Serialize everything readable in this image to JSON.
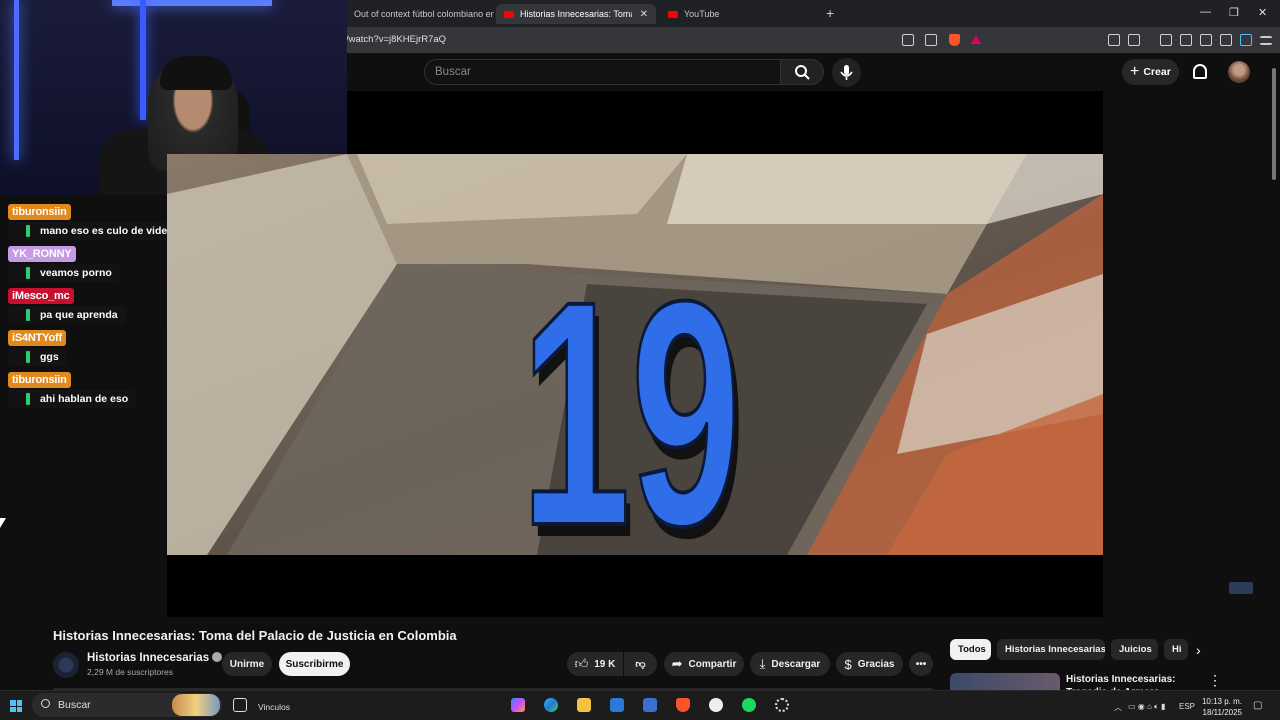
{
  "browser": {
    "tabs": [
      {
        "label": "Out of context fútbol colombiano en",
        "active": false
      },
      {
        "label": "Historias Innecesarias: Toma del",
        "active": true
      },
      {
        "label": "YouTube",
        "active": false
      }
    ],
    "url": "/watch?v=j8KHEjrR7aQ",
    "new_tab_icon": "plus-icon"
  },
  "youtube": {
    "search_placeholder": "Buscar",
    "create_label": "Crear",
    "video": {
      "overlay_numeral": "19",
      "title": "Historias Innecesarias: Toma del Palacio de Justicia en Colombia",
      "channel": "Historias Innecesarias",
      "subscribers": "2,29 M de suscriptores",
      "join_label": "Unirme",
      "subscribe_label": "Suscribirme",
      "likes": "19 K",
      "share_label": "Compartir",
      "download_label": "Descargar",
      "thanks_label": "Gracias"
    },
    "chips": [
      "Todos",
      "Historias Innecesarias",
      "Juicios",
      "Hi"
    ],
    "recommended": {
      "title": "Historias Innecesarias: Tragedia de Armero"
    }
  },
  "chat": {
    "messages": [
      {
        "user": "tiburonsiin",
        "color": "#e08a1e",
        "text": "mano eso es culo de video"
      },
      {
        "user": "YK_RONNY",
        "color": "#c79ae6",
        "text": "veamos porno"
      },
      {
        "user": "iMesco_mc",
        "color": "#c8102e",
        "text": "pa que aprenda"
      },
      {
        "user": "iS4NTYoff",
        "color": "#e08a1e",
        "text": "ggs"
      },
      {
        "user": "tiburonsiin",
        "color": "#e08a1e",
        "text": "ahi hablan de eso"
      }
    ]
  },
  "taskbar": {
    "search_placeholder": "Buscar",
    "widgets_label": "Vinculos",
    "language": "ESP",
    "time": "10:13 p. m.",
    "date": "18/11/2025"
  },
  "colors": {
    "accent_blue": "#2f6ee8",
    "youtube_red": "#ff0000"
  }
}
